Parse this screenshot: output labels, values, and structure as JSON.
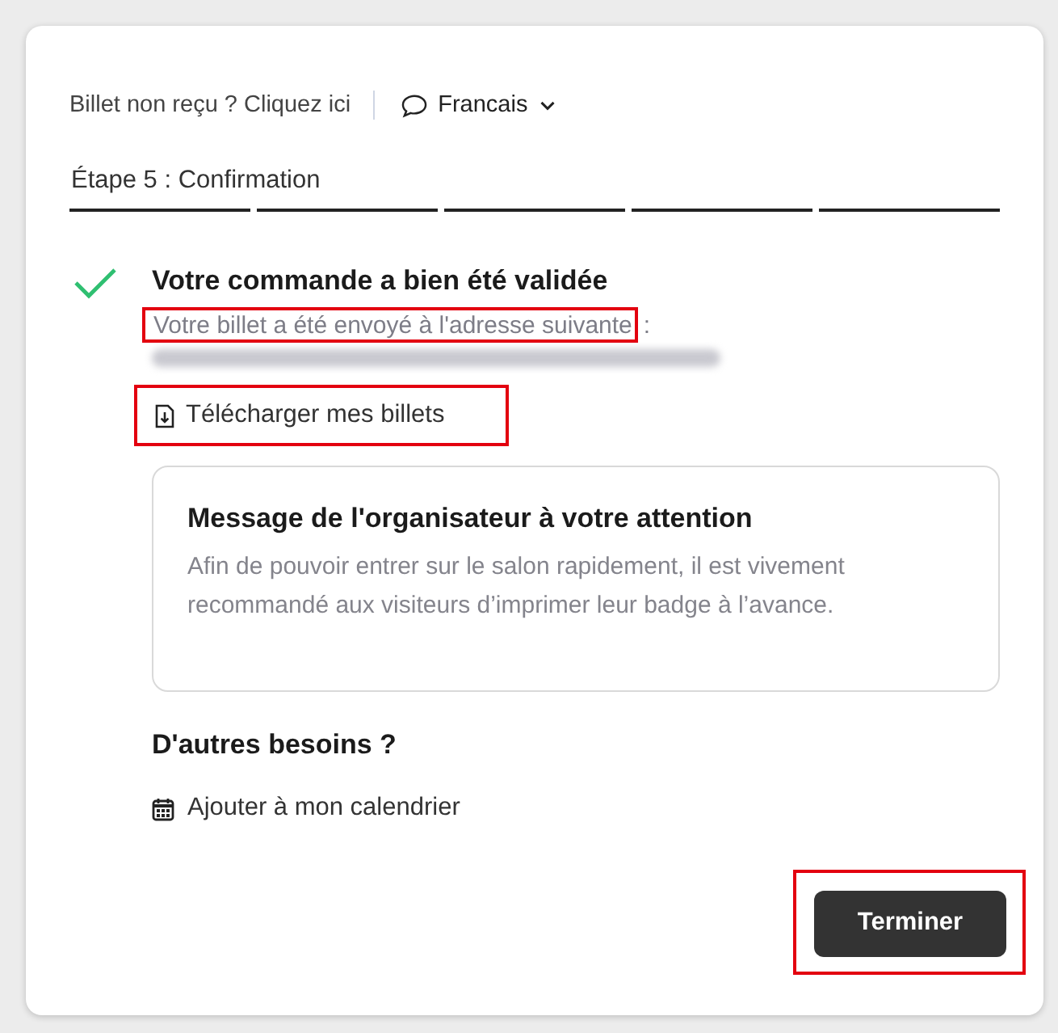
{
  "top_bar": {
    "link": "Billet non reçu ? Cliquez ici",
    "language": "Francais"
  },
  "stepper": {
    "label": "Étape 5 : Confirmation",
    "steps": [
      {
        "done": true
      },
      {
        "done": true
      },
      {
        "done": true
      },
      {
        "done": true
      },
      {
        "done": true
      }
    ]
  },
  "confirmation": {
    "title": "Votre commande a bien été validée",
    "notice": "Votre billet a été envoyé à l'adresse suivante",
    "notice_suffix": ":",
    "notice_highlighted": true,
    "email_redacted": true
  },
  "download": {
    "label": "Télécharger mes billets",
    "highlighted": true
  },
  "message": {
    "title": "Message de l'organisateur à votre attention",
    "body": "Afin de pouvoir entrer sur le salon rapidement, il est vivement recommandé aux visiteurs d’imprimer leur badge à l’avance."
  },
  "other_needs": {
    "title": "D'autres besoins ?",
    "calendar_link": "Ajouter à mon calendrier"
  },
  "finish_button": {
    "label": "Terminer",
    "highlighted": true
  }
}
